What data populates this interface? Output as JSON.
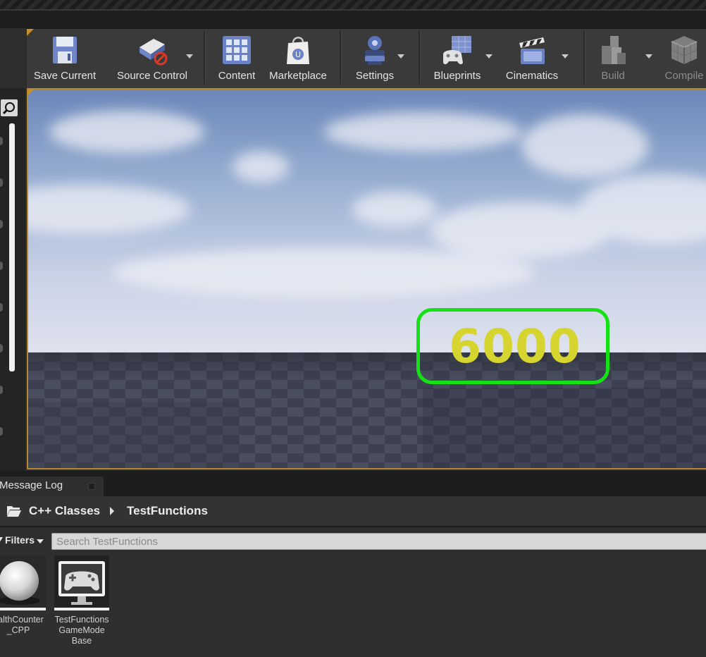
{
  "toolbar": {
    "buttons": [
      {
        "label": "Save Current",
        "icon": "save-disk-icon"
      },
      {
        "label": "Source Control",
        "icon": "source-control-icon",
        "has_dropdown": true
      },
      {
        "label": "Content",
        "icon": "content-browser-icon"
      },
      {
        "label": "Marketplace",
        "icon": "marketplace-bag-icon"
      },
      {
        "label": "Settings",
        "icon": "settings-gear-icon",
        "has_dropdown": true
      },
      {
        "label": "Blueprints",
        "icon": "blueprint-gamepad-icon",
        "has_dropdown": true
      },
      {
        "label": "Cinematics",
        "icon": "clapperboard-icon",
        "has_dropdown": true
      },
      {
        "label": "Build",
        "icon": "build-blocks-icon",
        "has_dropdown": true,
        "enabled": false
      },
      {
        "label": "Compile",
        "icon": "compile-cubes-icon",
        "enabled": false
      }
    ]
  },
  "viewport": {
    "hud_counter": "6000",
    "hud_border_color": "#16e016",
    "hud_text_color": "#d6d52f"
  },
  "tabs": {
    "message_log": "Message Log"
  },
  "content_browser": {
    "breadcrumb": [
      "C++ Classes",
      "TestFunctions"
    ],
    "filters_label": "Filters",
    "search_placeholder": "Search TestFunctions",
    "assets": [
      {
        "name": "ealthCounter\n_CPP",
        "icon": "sphere-thumbnail-icon"
      },
      {
        "name": "TestFunctions\nGameMode\nBase",
        "icon": "gamepad-monitor-icon"
      }
    ]
  },
  "colors": {
    "accent": "#b8862c",
    "background": "#2b2b2b",
    "toolbar": "#3a3a3a"
  }
}
